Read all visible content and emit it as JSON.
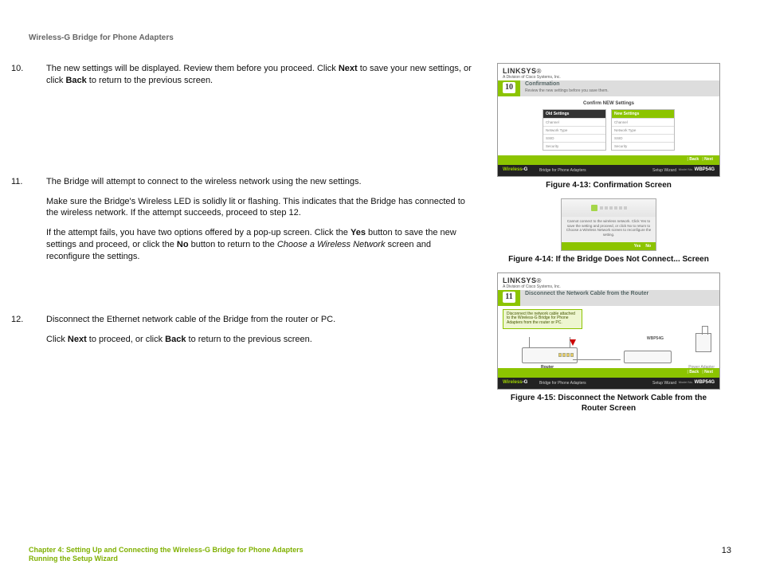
{
  "header": "Wireless-G Bridge for Phone Adapters",
  "steps": {
    "s10": {
      "num": "10.",
      "p1a": "The new settings will be displayed. Review them before you proceed. Click ",
      "p1b": "Next",
      "p1c": " to save your new settings, or click ",
      "p1d": "Back",
      "p1e": " to return to the previous screen."
    },
    "s11": {
      "num": "11.",
      "p1": "The Bridge will attempt to connect to the wireless network using the new settings.",
      "p2": "Make sure the Bridge's Wireless LED is solidly lit or flashing. This indicates that the Bridge has connected to the wireless network. If the attempt succeeds, proceed to step 12.",
      "p3a": "If the attempt fails, you have two options offered by a pop-up screen. Click the ",
      "p3b": "Yes",
      "p3c": " button to save the new settings and proceed, or click the ",
      "p3d": "No",
      "p3e": " button to return to the ",
      "p3f": "Choose a Wireless Network",
      "p3g": " screen and reconfigure the settings."
    },
    "s12": {
      "num": "12.",
      "p1": "Disconnect the Ethernet network cable of the Bridge from the router or PC.",
      "p2a": "Click ",
      "p2b": "Next",
      "p2c": " to proceed, or click ",
      "p2d": "Back",
      "p2e": " to return to the previous screen."
    }
  },
  "captions": {
    "c13": "Figure 4-13: Confirmation Screen",
    "c14": "Figure 4-14: If the Bridge Does Not Connect... Screen",
    "c15a": "Figure 4-15: Disconnect the Network Cable from the",
    "c15b": "Router Screen"
  },
  "footer": {
    "line1": "Chapter 4: Setting Up and Connecting the Wireless-G Bridge for Phone Adapters",
    "line2": "Running the Setup Wizard",
    "page": "13"
  },
  "thumbs": {
    "brand": "LINKSYS",
    "brand_sub": "A Division of Cisco Systems, Inc.",
    "reg": "®",
    "model": "WBP54G",
    "model_lbl": "Model No.",
    "setup_wizard": "Setup Wizard",
    "wireless_label": "Wireless",
    "g_label": "-G",
    "bridge_label": "Bridge for Phone Adapters",
    "back": "Back",
    "next": "Next",
    "confirm": {
      "num": "10",
      "title": "Confirmation",
      "sub": "Review the new settings before you save them.",
      "heading": "Confirm NEW Settings",
      "old_hdr": "Old Settings",
      "new_hdr": "New Settings",
      "rows": [
        "Channel",
        "Network Type",
        "SSID",
        "Security"
      ]
    },
    "popup": {
      "msg": "Cannot connect to the wireless network. Click Yes to save the setting and proceed, or click No to return to Choose a Wireless Network screen to reconfigure the setting.",
      "yes": "Yes",
      "no": "No"
    },
    "disconnect": {
      "num": "11",
      "title": "Disconnect the Network Cable from the Router",
      "box": "Disconnect the network cable attached to the Wireless-G Bridge for Phone Adapters from the router or PC.",
      "router": "Router",
      "bridge_mdl": "WBP54G",
      "power": "Power Adapter"
    }
  }
}
